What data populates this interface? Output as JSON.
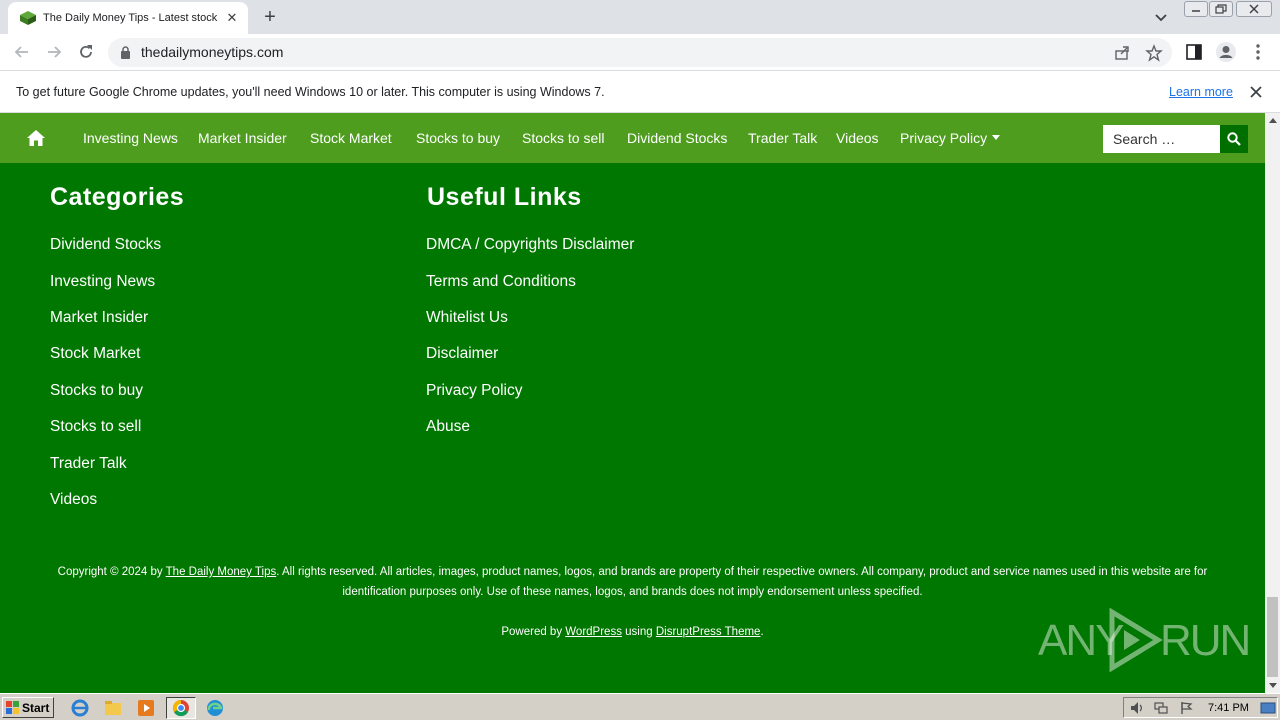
{
  "browser": {
    "tab_title": "The Daily Money Tips - Latest stock market news",
    "url": "thedailymoneytips.com"
  },
  "infobar": {
    "message": "To get future Google Chrome updates, you'll need Windows 10 or later. This computer is using Windows 7.",
    "learn_more": "Learn more"
  },
  "site": {
    "nav": [
      {
        "label": "Investing News"
      },
      {
        "label": "Market Insider"
      },
      {
        "label": "Stock Market"
      },
      {
        "label": "Stocks to buy"
      },
      {
        "label": "Stocks to sell"
      },
      {
        "label": "Dividend Stocks"
      },
      {
        "label": "Trader Talk"
      },
      {
        "label": "Videos"
      },
      {
        "label": "Privacy Policy"
      }
    ],
    "search_placeholder": "Search …",
    "categories": {
      "heading": "Categories",
      "links": [
        "Dividend Stocks",
        "Investing News",
        "Market Insider",
        "Stock Market",
        "Stocks to buy",
        "Stocks to sell",
        "Trader Talk",
        "Videos"
      ]
    },
    "useful_links": {
      "heading": "Useful Links",
      "links": [
        "DMCA / Copyrights Disclaimer",
        "Terms and Conditions",
        "Whitelist Us",
        "Disclaimer",
        "Privacy Policy",
        "Abuse"
      ]
    },
    "footer": {
      "copyright_prefix": "Copyright © 2024 by ",
      "site_name": "The Daily Money Tips",
      "copyright_rest": ". All rights reserved. All articles, images, product names, logos, and brands are property of their respective owners. All company, product and service names used in this website are for identification purposes only. Use of these names, logos, and brands does not imply endorsement unless specified.",
      "powered_prefix": "Powered by ",
      "wordpress": "WordPress",
      "using": " using ",
      "theme": "DisruptPress Theme",
      "period": "."
    }
  },
  "watermark": {
    "any": "ANY",
    "run": "RUN"
  },
  "taskbar": {
    "start_label": "Start",
    "clock": "7:41 PM"
  }
}
